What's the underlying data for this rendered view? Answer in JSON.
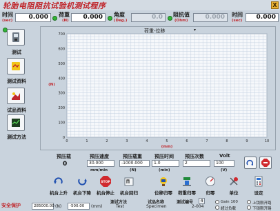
{
  "app": {
    "title": "轮胎电阻阻抗试验机测试程序",
    "close_label": "X"
  },
  "readouts": {
    "time": {
      "label": "时间",
      "unit": "(sec)",
      "value": "0.000"
    },
    "load": {
      "label": "荷重",
      "unit": "(N)",
      "value": "0.000"
    },
    "angle": {
      "label": "角度",
      "unit": "(Deg.)",
      "value": "0.0"
    },
    "resistance": {
      "label": "阻抗值",
      "unit": "(Ohm)",
      "value": "0.000"
    },
    "time2": {
      "label": "时间",
      "unit": "(sec)",
      "value": "0.000"
    }
  },
  "sidebar": {
    "items": [
      {
        "label": "测试"
      },
      {
        "label": "测试资料"
      },
      {
        "label": "试品资料"
      },
      {
        "label": "测试方法"
      }
    ]
  },
  "chart": {
    "selector_label": "荷重-位移",
    "y_unit": "(N)",
    "x_unit": "(mm)"
  },
  "chart_data": {
    "type": "line",
    "title": "荷重-位移",
    "xlabel": "(mm)",
    "ylabel": "(N)",
    "xlim": [
      0,
      10
    ],
    "ylim": [
      0,
      700
    ],
    "x_ticks": [
      "0",
      "1",
      "2",
      "3",
      "4",
      "5",
      "6",
      "7",
      "8",
      "9",
      "10"
    ],
    "y_ticks": [
      "0",
      "100",
      "200",
      "300",
      "400",
      "500",
      "600",
      "700"
    ],
    "grid": true,
    "series": []
  },
  "params": {
    "preload": {
      "label": "预压载",
      "value": "0"
    },
    "speed": {
      "label": "预压速度",
      "value": "30.000",
      "unit": "mm/min"
    },
    "load": {
      "label": "预压载重",
      "value": "-1000.000",
      "unit": "(N)"
    },
    "time": {
      "label": "预压时间",
      "value": "1.0",
      "unit": "(min)"
    },
    "count": {
      "label": "预压次数",
      "value": "2"
    },
    "volt": {
      "label": "Volt",
      "value": "100",
      "unit": "(V)"
    }
  },
  "toolbar": {
    "up": "机台上升",
    "down": "机台下降",
    "stop": "机台停止",
    "home": "机台回归",
    "disp_zero": "位移归零",
    "load_zero": "荷重归零",
    "zero": "归零",
    "unit": "单位",
    "settings": "设定"
  },
  "status": {
    "safety": "安全保护",
    "upper": "285000.00",
    "upper_unit": "(N)",
    "lower": "-500.00",
    "lower_unit": "(mm)",
    "method_label": "测试方法",
    "method_value": "Test",
    "sample_label": "试品名称",
    "sample_value": "Specimen",
    "number_label": "测试编号",
    "number_value": "4",
    "number_sub": "2-004",
    "gain": "Gain 100",
    "overload": "超过负载",
    "upper_limit": "上锁限开路",
    "lower_limit": "下锁限开路"
  }
}
